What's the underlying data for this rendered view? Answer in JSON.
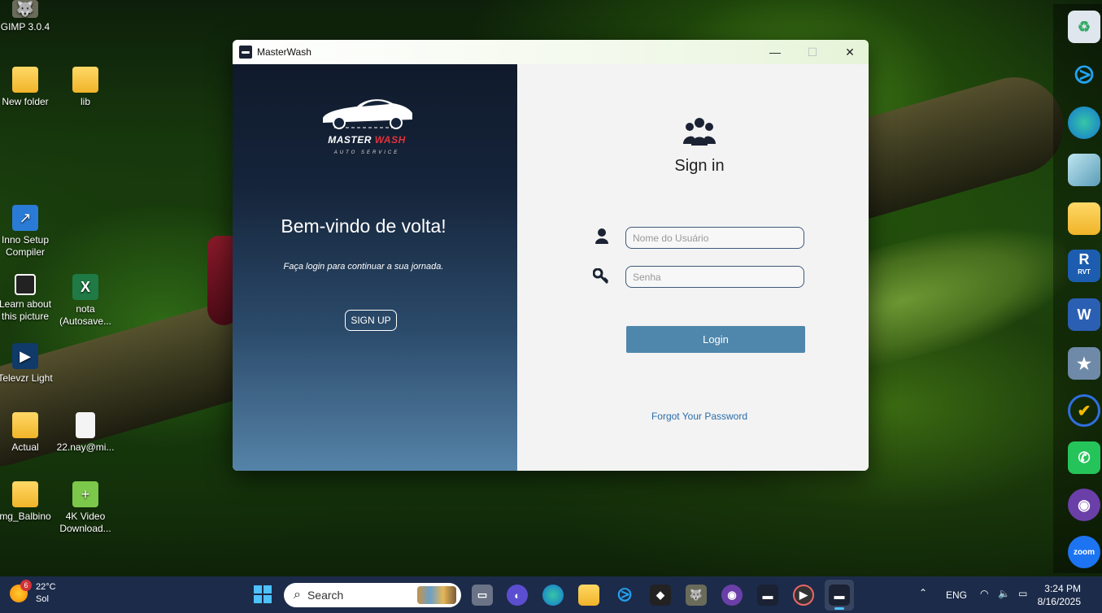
{
  "desktop": {
    "icons": [
      {
        "label": "GIMP 3.0.4"
      },
      {
        "label": "New folder"
      },
      {
        "label": "lib"
      },
      {
        "label": "Inno Setup Compiler"
      },
      {
        "label": "Learn about this picture"
      },
      {
        "label": "nota (Autosave..."
      },
      {
        "label": "Televzr Light"
      },
      {
        "label": "Actual"
      },
      {
        "label": "22.nay@mi..."
      },
      {
        "label": "mg_Balbino"
      },
      {
        "label": "4K Video Download..."
      }
    ],
    "right_icons": [
      {
        "name": "recycle-bin-icon"
      },
      {
        "name": "vscode-icon"
      },
      {
        "name": "edge-icon"
      },
      {
        "name": "app-icon"
      },
      {
        "name": "file-explorer-icon"
      },
      {
        "name": "revit-icon",
        "text": "R",
        "sub": "RVT"
      },
      {
        "name": "word-icon",
        "text": "W"
      },
      {
        "name": "star-app-icon"
      },
      {
        "name": "todo-icon"
      },
      {
        "name": "whatsapp-icon"
      },
      {
        "name": "github-icon"
      },
      {
        "name": "zoom-icon",
        "text": "zoom"
      }
    ]
  },
  "window": {
    "title": "MasterWash",
    "controls": {
      "minimize": "—",
      "maximize": "☐",
      "close": "✕"
    }
  },
  "left_panel": {
    "logo_word1": "MASTER",
    "logo_word2": "WASH",
    "logo_sub": "AUTO SERVICE",
    "welcome": "Bem-vindo de volta!",
    "subtitle": "Faça login para continuar a sua jornada.",
    "signup_label": "SIGN UP"
  },
  "right_panel": {
    "title": "Sign in",
    "username_placeholder": "Nome do Usuário",
    "password_placeholder": "Senha",
    "login_label": "Login",
    "forgot_label": "Forgot Your Password"
  },
  "taskbar": {
    "weather_temp": "22°C",
    "weather_desc": "Sol",
    "weather_badge": "6",
    "search_placeholder": "Search",
    "lang": "ENG",
    "time": "3:24 PM",
    "date": "8/16/2025"
  },
  "colors": {
    "accent_button": "#4f86ab",
    "link": "#2a6ca8",
    "panel_dark": "#101a2c",
    "logo_red": "#e2323b"
  }
}
